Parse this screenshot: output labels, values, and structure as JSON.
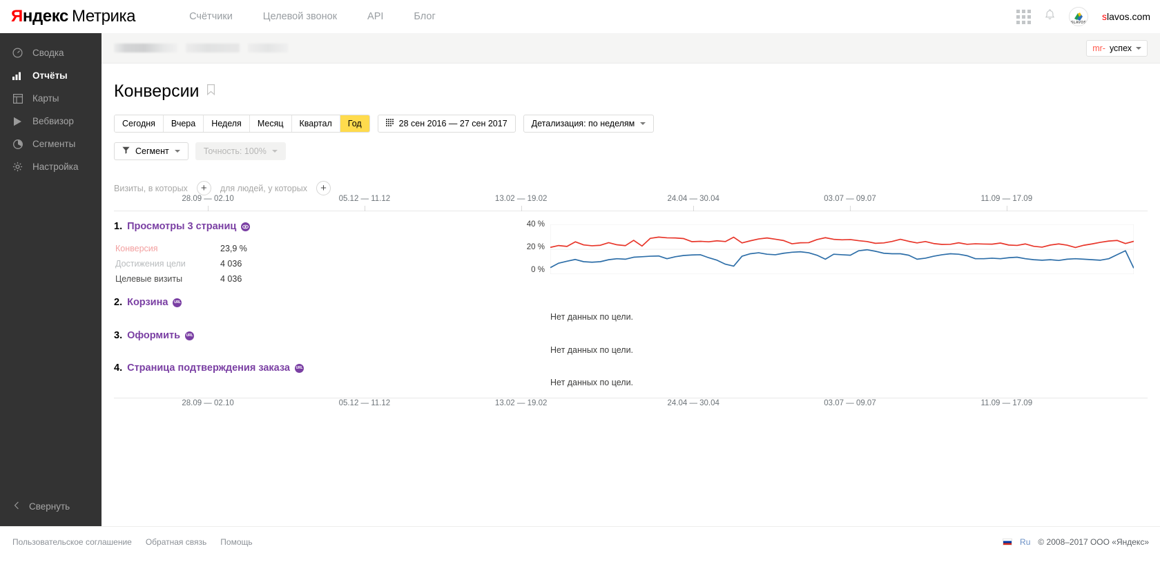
{
  "topbar": {
    "logo": {
      "ya": "Я",
      "ndex": "ндекс",
      "metrika": "Метрика"
    },
    "nav": [
      {
        "label": "Счётчики",
        "name": "nav-counters"
      },
      {
        "label": "Целевой звонок",
        "name": "nav-target-call"
      },
      {
        "label": "API",
        "name": "nav-api"
      },
      {
        "label": "Блог",
        "name": "nav-blog"
      }
    ],
    "avatar_text": "SLAVOS",
    "username_first": "s",
    "username_rest": "lavos.com"
  },
  "sidebar": {
    "items": [
      {
        "label": "Сводка",
        "icon": "gauge-icon",
        "active": false
      },
      {
        "label": "Отчёты",
        "icon": "bar-chart-icon",
        "active": true
      },
      {
        "label": "Карты",
        "icon": "layout-icon",
        "active": false
      },
      {
        "label": "Вебвизор",
        "icon": "play-icon",
        "active": false
      },
      {
        "label": "Сегменты",
        "icon": "pie-icon",
        "active": false
      },
      {
        "label": "Настройка",
        "icon": "gear-icon",
        "active": false
      }
    ],
    "collapse_label": "Свернуть"
  },
  "breadcrumb": {
    "counter_prefix": "mr-",
    "counter_name": "успех"
  },
  "page": {
    "title": "Конверсии",
    "periods": [
      {
        "label": "Сегодня",
        "selected": false
      },
      {
        "label": "Вчера",
        "selected": false
      },
      {
        "label": "Неделя",
        "selected": false
      },
      {
        "label": "Месяц",
        "selected": false
      },
      {
        "label": "Квартал",
        "selected": false
      },
      {
        "label": "Год",
        "selected": true
      }
    ],
    "date_range": "28 сен 2016 — 27 сен 2017",
    "detail_label": "Детализация: по неделям",
    "segment_label": "Сегмент",
    "accuracy_label": "Точность: 100%",
    "cond_visits": "Визиты, в которых",
    "cond_people": "для людей, у которых",
    "plus": "+"
  },
  "goals": [
    {
      "num": "1.",
      "name": "Просмотры 3 страниц",
      "badge": "◉",
      "badge_kind": "views",
      "metrics": [
        {
          "key": "Конверсия",
          "value": "23,9 %",
          "style": "conv"
        },
        {
          "key": "Достижения цели",
          "value": "4 036",
          "style": "grey"
        },
        {
          "key": "Целевые визиты",
          "value": "4 036",
          "style": "dark"
        }
      ],
      "has_chart": true,
      "no_data": ""
    },
    {
      "num": "2.",
      "name": "Корзина",
      "badge": "URL",
      "badge_kind": "url",
      "metrics": [],
      "has_chart": false,
      "no_data": "Нет данных по цели."
    },
    {
      "num": "3.",
      "name": "Оформить",
      "badge": "URL",
      "badge_kind": "url",
      "metrics": [],
      "has_chart": false,
      "no_data": "Нет данных по цели."
    },
    {
      "num": "4.",
      "name": "Страница подтверждения заказа",
      "badge": "URL",
      "badge_kind": "url",
      "metrics": [],
      "has_chart": false,
      "no_data": "Нет данных по цели."
    }
  ],
  "chart_data": {
    "type": "line",
    "title": "",
    "xlabel": "",
    "ylabel": "",
    "grid": true,
    "legend": "none",
    "x_ticks": [
      "28.09 — 02.10",
      "05.12 — 11.12",
      "13.02 — 19.02",
      "24.04 — 30.04",
      "03.07 — 09.07",
      "11.09 — 17.09"
    ],
    "x_tick_positions": [
      0.0909,
      0.2424,
      0.3939,
      0.5606,
      0.7121,
      0.8636
    ],
    "y_left_ticks": [
      "0 %",
      "20 %",
      "40 %"
    ],
    "y_left_lim": [
      0,
      40
    ],
    "y_right_ticks": [
      "0",
      "100",
      "200"
    ],
    "y_right_lim": [
      0,
      200
    ],
    "series": [
      {
        "name": "Конверсия",
        "color": "#e8362a",
        "axis": "left",
        "values": [
          21.5,
          23.0,
          22.3,
          26.0,
          23.5,
          22.8,
          23.2,
          25.3,
          23.6,
          22.9,
          27.2,
          22.6,
          28.8,
          29.8,
          29.2,
          29.1,
          28.6,
          26.1,
          26.4,
          26.0,
          26.8,
          26.2,
          29.7,
          25.1,
          26.8,
          28.3,
          29.1,
          28.1,
          27.0,
          24.4,
          25.2,
          25.3,
          27.8,
          29.3,
          28.0,
          27.6,
          27.8,
          26.9,
          26.2,
          24.8,
          25.1,
          26.3,
          28.0,
          26.4,
          25.1,
          26.2,
          24.6,
          23.9,
          24.0,
          25.2,
          24.0,
          24.4,
          24.2,
          24.1,
          25.0,
          23.4,
          23.1,
          24.3,
          22.4,
          21.7,
          23.4,
          24.3,
          23.3,
          21.4,
          23.2,
          24.3,
          25.6,
          26.6,
          27.1,
          24.6,
          26.4
        ]
      },
      {
        "name": "Целевые визиты",
        "color": "#2d6ea8",
        "axis": "right",
        "values": [
          26,
          44,
          52,
          59,
          50,
          48,
          50,
          58,
          62,
          60,
          68,
          70,
          72,
          73,
          62,
          70,
          75,
          77,
          78,
          66,
          56,
          40,
          32,
          72,
          82,
          86,
          80,
          78,
          84,
          88,
          90,
          86,
          76,
          60,
          80,
          78,
          76,
          94,
          98,
          92,
          84,
          82,
          82,
          76,
          60,
          64,
          72,
          78,
          82,
          80,
          74,
          62,
          62,
          64,
          62,
          66,
          68,
          62,
          58,
          56,
          58,
          55,
          60,
          62,
          60,
          58,
          56,
          62,
          78,
          94,
          24
        ]
      }
    ]
  },
  "footer": {
    "links": [
      "Пользовательское соглашение",
      "Обратная связь",
      "Помощь"
    ],
    "lang": "Ru",
    "copyright": "© 2008–2017  ООО «Яндекс»"
  }
}
